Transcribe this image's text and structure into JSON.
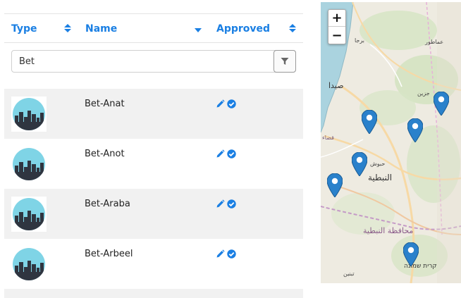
{
  "table": {
    "columns": [
      {
        "label": "Type"
      },
      {
        "label": "Name"
      },
      {
        "label": "Approved"
      }
    ],
    "filter": {
      "value": "Bet",
      "placeholder": ""
    },
    "rows": [
      {
        "name": "Bet-Anat",
        "approved": true
      },
      {
        "name": "Bet-Anot",
        "approved": true
      },
      {
        "name": "Bet-Araba",
        "approved": true
      },
      {
        "name": "Bet-Arbeel",
        "approved": true
      }
    ]
  },
  "map": {
    "zoom_in_label": "+",
    "zoom_out_label": "−",
    "labels": {
      "barja": "برجا",
      "ammatour": "عماطور",
      "saida": "صيدا",
      "jezzine": "جزين",
      "qasr": "قضاء",
      "habbouch": "حبوش",
      "nabatieh": "النبطية",
      "nabatieh_gov": "محافظة النبطية",
      "kiryat_shmona": "קרית שמונה",
      "tebnine": "تبنين"
    },
    "marker_count": 6
  },
  "colors": {
    "accent": "#1a7fe3",
    "marker": "#2a81cb",
    "row_alt": "#f1f1f1",
    "sea": "#aad3df"
  },
  "icons": {
    "sort": "sort-both-icon",
    "sort_desc": "sort-down-icon",
    "filter": "filter-icon",
    "edit": "pencil-icon",
    "approved": "check-circle-icon",
    "thumbnail": "city-skyline-icon",
    "marker": "map-marker-icon"
  }
}
